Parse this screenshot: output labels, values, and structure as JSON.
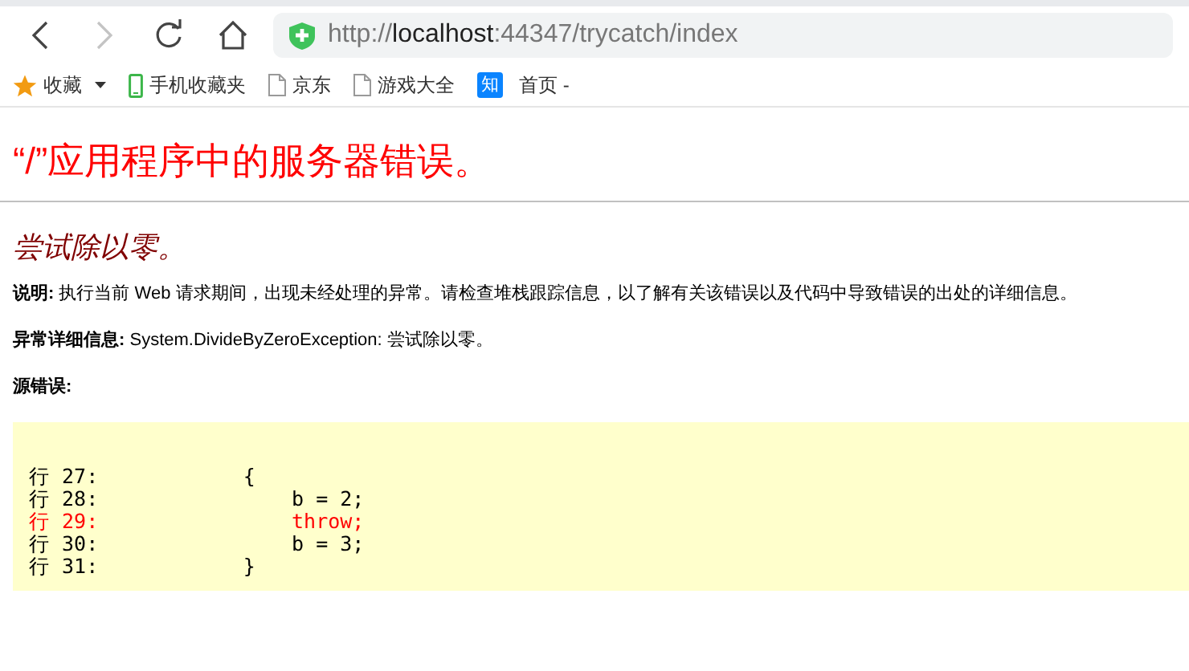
{
  "toolbar": {
    "back": {
      "disabled": false
    },
    "forward": {
      "disabled": true
    },
    "address": {
      "scheme": "http://",
      "host": "localhost",
      "path": ":44347/trycatch/index"
    }
  },
  "bookmarks": [
    {
      "kind": "star",
      "label": "收藏",
      "dropdown": true
    },
    {
      "kind": "phone",
      "label": "手机收藏夹"
    },
    {
      "kind": "page",
      "label": "京东"
    },
    {
      "kind": "page",
      "label": "游戏大全"
    },
    {
      "kind": "badge",
      "badge": "知",
      "label": "首页 -"
    }
  ],
  "page": {
    "title": "“/”应用程序中的服务器错误。",
    "message": "尝试除以零。",
    "details": [
      {
        "label": "说明:",
        "text": "执行当前 Web 请求期间，出现未经处理的异常。请检查堆栈跟踪信息，以了解有关该错误以及代码中导致错误的出处的详细信息。"
      },
      {
        "label": "异常详细信息:",
        "text": "System.DivideByZeroException: 尝试除以零。"
      },
      {
        "label": "源错误:"
      }
    ],
    "source_lines": [
      {
        "text": "行 27:            {",
        "error": false
      },
      {
        "text": "行 28:                b = 2;",
        "error": false
      },
      {
        "text": "行 29:                throw;",
        "error": true
      },
      {
        "text": "行 30:                b = 3;",
        "error": false
      },
      {
        "text": "行 31:            }",
        "error": false
      }
    ]
  }
}
